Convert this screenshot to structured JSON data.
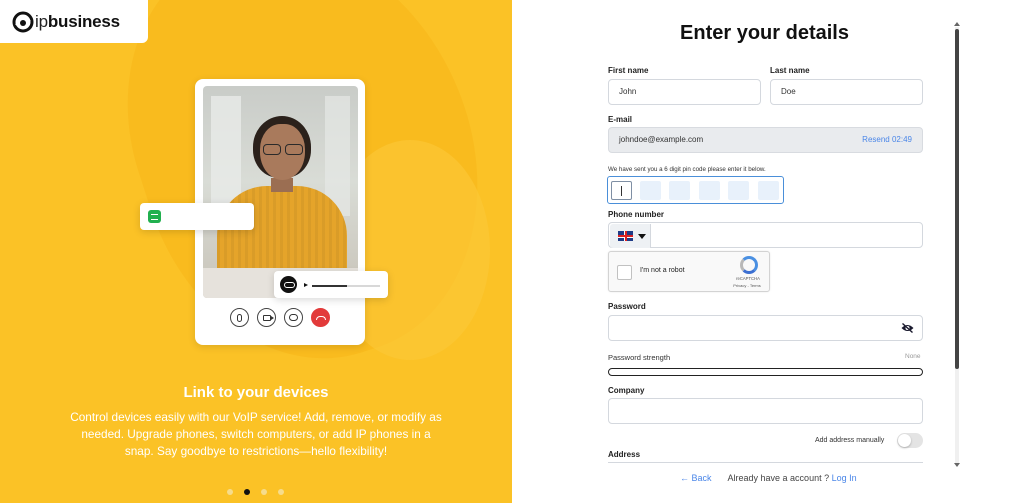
{
  "brand": {
    "logo_text_strong": "business",
    "logo_text_prefix": "ip",
    "brand_color": "#fbc226"
  },
  "carousel": {
    "title": "Link to your devices",
    "description": "Control devices easily with our VoIP service! Add, remove, or modify as needed. Upgrade phones, switch computers, or add IP phones in a snap. Say goodbye to restrictions—hello flexibility!",
    "dots": [
      {
        "active": false
      },
      {
        "active": true
      },
      {
        "active": false
      },
      {
        "active": false
      }
    ]
  },
  "form": {
    "title": "Enter your details",
    "first_name": {
      "label": "First name",
      "value": "John"
    },
    "last_name": {
      "label": "Last name",
      "value": "Doe"
    },
    "email": {
      "label": "E-mail",
      "value": "johndoe@example.com",
      "resend": "Resend 02:49"
    },
    "pin_note": "We have sent you a 6 digit pin code please enter it below.",
    "pin_boxes": 6,
    "phone": {
      "label": "Phone number",
      "country_icon": "uk-flag-icon"
    },
    "recaptcha": {
      "label": "I'm not a robot",
      "brand": "reCAPTCHA",
      "links": "Privacy - Terms"
    },
    "password": {
      "label": "Password"
    },
    "password_strength": {
      "label": "Password strength",
      "value": "None"
    },
    "company": {
      "label": "Company"
    },
    "add_address_manually": "Add address manually",
    "address": {
      "label": "Address"
    },
    "back": "← Back",
    "already": "Already have a account ?",
    "login": "Log In",
    "accent_color": "#4a86e8"
  }
}
